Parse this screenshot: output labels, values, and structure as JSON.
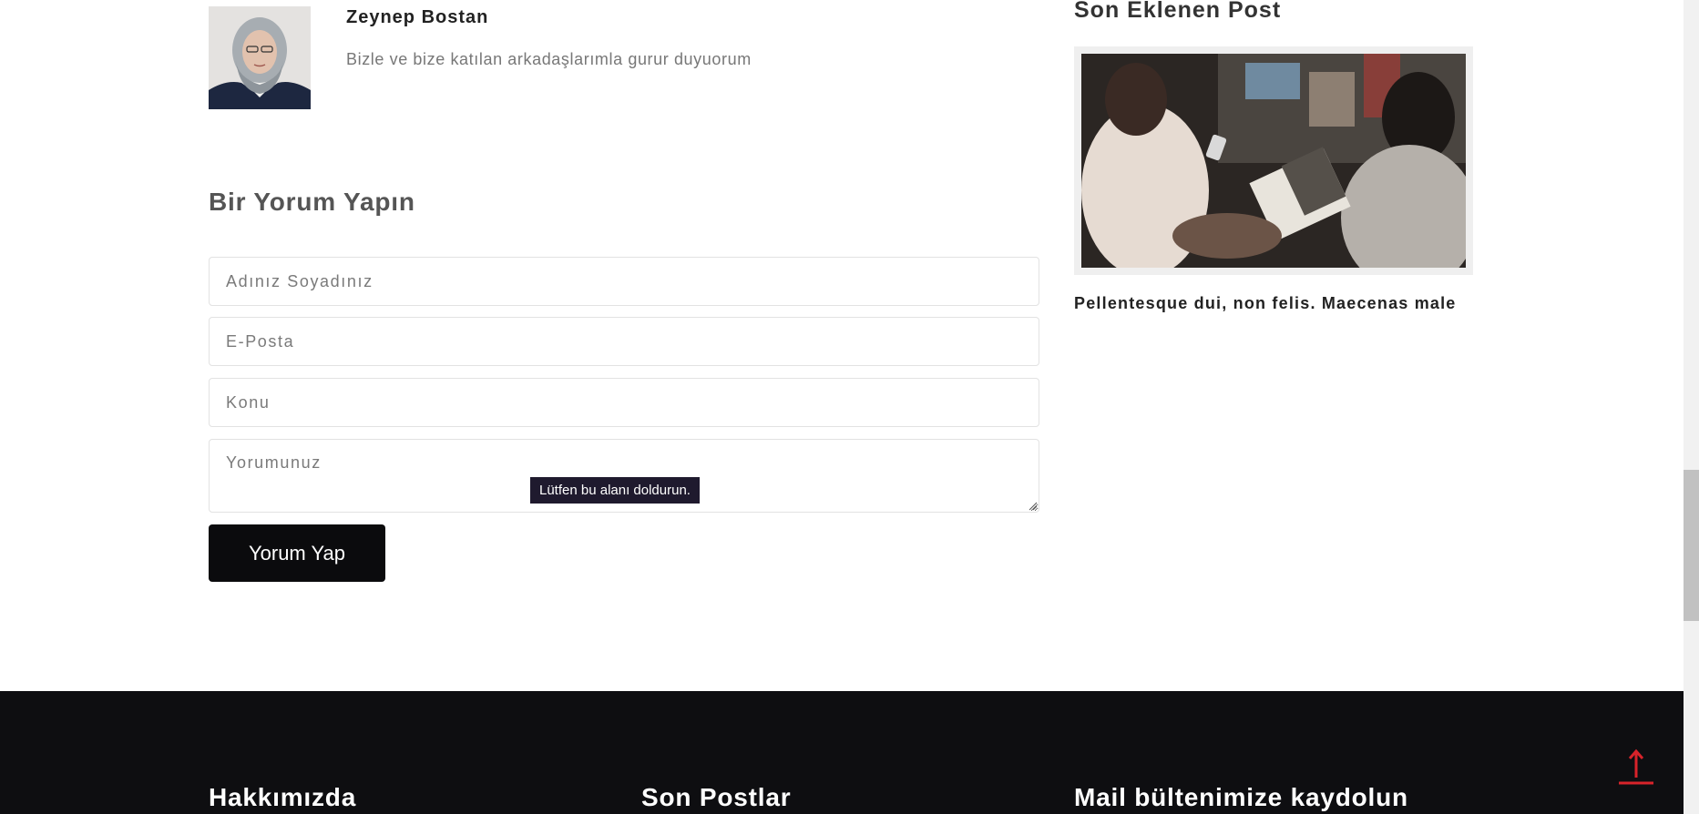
{
  "author": {
    "name": "Zeynep Bostan",
    "bio": "Bizle ve bize katılan arkadaşlarımla gurur duyuorum"
  },
  "comment_form": {
    "title": "Bir Yorum Yapın",
    "name_placeholder": "Adınız Soyadınız",
    "email_placeholder": "E-Posta",
    "subject_placeholder": "Konu",
    "comment_placeholder": "Yorumunuz",
    "validation_tooltip": "Lütfen bu alanı doldurun.",
    "submit_label": "Yorum Yap"
  },
  "sidebar": {
    "title": "Son Eklenen Post",
    "post_title": "Pellentesque dui, non felis. Maecenas male"
  },
  "footer": {
    "about_heading": "Hakkımızda",
    "posts_heading": "Son Postlar",
    "newsletter_heading": "Mail bültenimize kaydolun"
  },
  "colors": {
    "footer_bg": "#0e0e11",
    "button_bg": "#0b0b0d",
    "back_to_top": "#d8232a"
  },
  "icons": {
    "back_to_top": "arrow-up-icon"
  }
}
